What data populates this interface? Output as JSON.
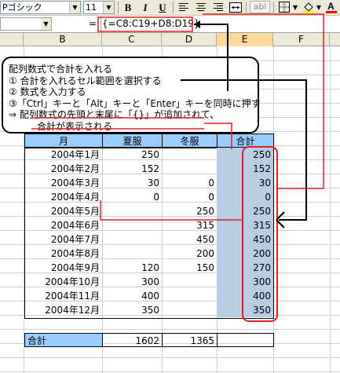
{
  "toolbar": {
    "font_name": "Pゴシック",
    "font_size": "11",
    "bold": "B",
    "italic": "I",
    "underline": "U",
    "abl": "abl"
  },
  "formula_bar": {
    "equals": "=",
    "formula": "{=C8:C19+D8:D19}"
  },
  "columns": [
    "B",
    "C",
    "D",
    "E",
    "F"
  ],
  "callout": {
    "line1": "配列数式で合計を入れる",
    "line2": "① 合計を入れるセル範囲を選択する",
    "line3": "② 数式を入力する",
    "line4": "③「Ctrl」キーと「Alt」キーと「Enter」キーを同時に押す",
    "line5": "⇒ 配列数式の先頭と末尾に「{}」が追加されて、",
    "line6": "合計が表示される"
  },
  "table": {
    "headers": [
      "月",
      "夏服",
      "冬服",
      "合計"
    ],
    "rows": [
      {
        "month": "2004年1月",
        "summer": "250",
        "winter": "",
        "total": "250"
      },
      {
        "month": "2004年2月",
        "summer": "152",
        "winter": "",
        "total": "152"
      },
      {
        "month": "2004年3月",
        "summer": "30",
        "winter": "0",
        "total": "30"
      },
      {
        "month": "2004年4月",
        "summer": "0",
        "winter": "0",
        "total": "0"
      },
      {
        "month": "2004年5月",
        "summer": "",
        "winter": "250",
        "total": "250"
      },
      {
        "month": "2004年6月",
        "summer": "",
        "winter": "315",
        "total": "315"
      },
      {
        "month": "2004年7月",
        "summer": "",
        "winter": "450",
        "total": "450"
      },
      {
        "month": "2004年8月",
        "summer": "",
        "winter": "200",
        "total": "200"
      },
      {
        "month": "2004年9月",
        "summer": "120",
        "winter": "150",
        "total": "270"
      },
      {
        "month": "2004年10月",
        "summer": "300",
        "winter": "",
        "total": "300"
      },
      {
        "month": "2004年11月",
        "summer": "400",
        "winter": "",
        "total": "400"
      },
      {
        "month": "2004年12月",
        "summer": "350",
        "winter": "",
        "total": "350"
      }
    ],
    "summary": {
      "label": "合計",
      "summer": "1602",
      "winter": "1365",
      "total": ""
    }
  },
  "colors": {
    "header_fill": "#99ccff",
    "selection_fill": "#b8cce4",
    "annotation_red": "#e02020",
    "callout_border": "#000000"
  }
}
